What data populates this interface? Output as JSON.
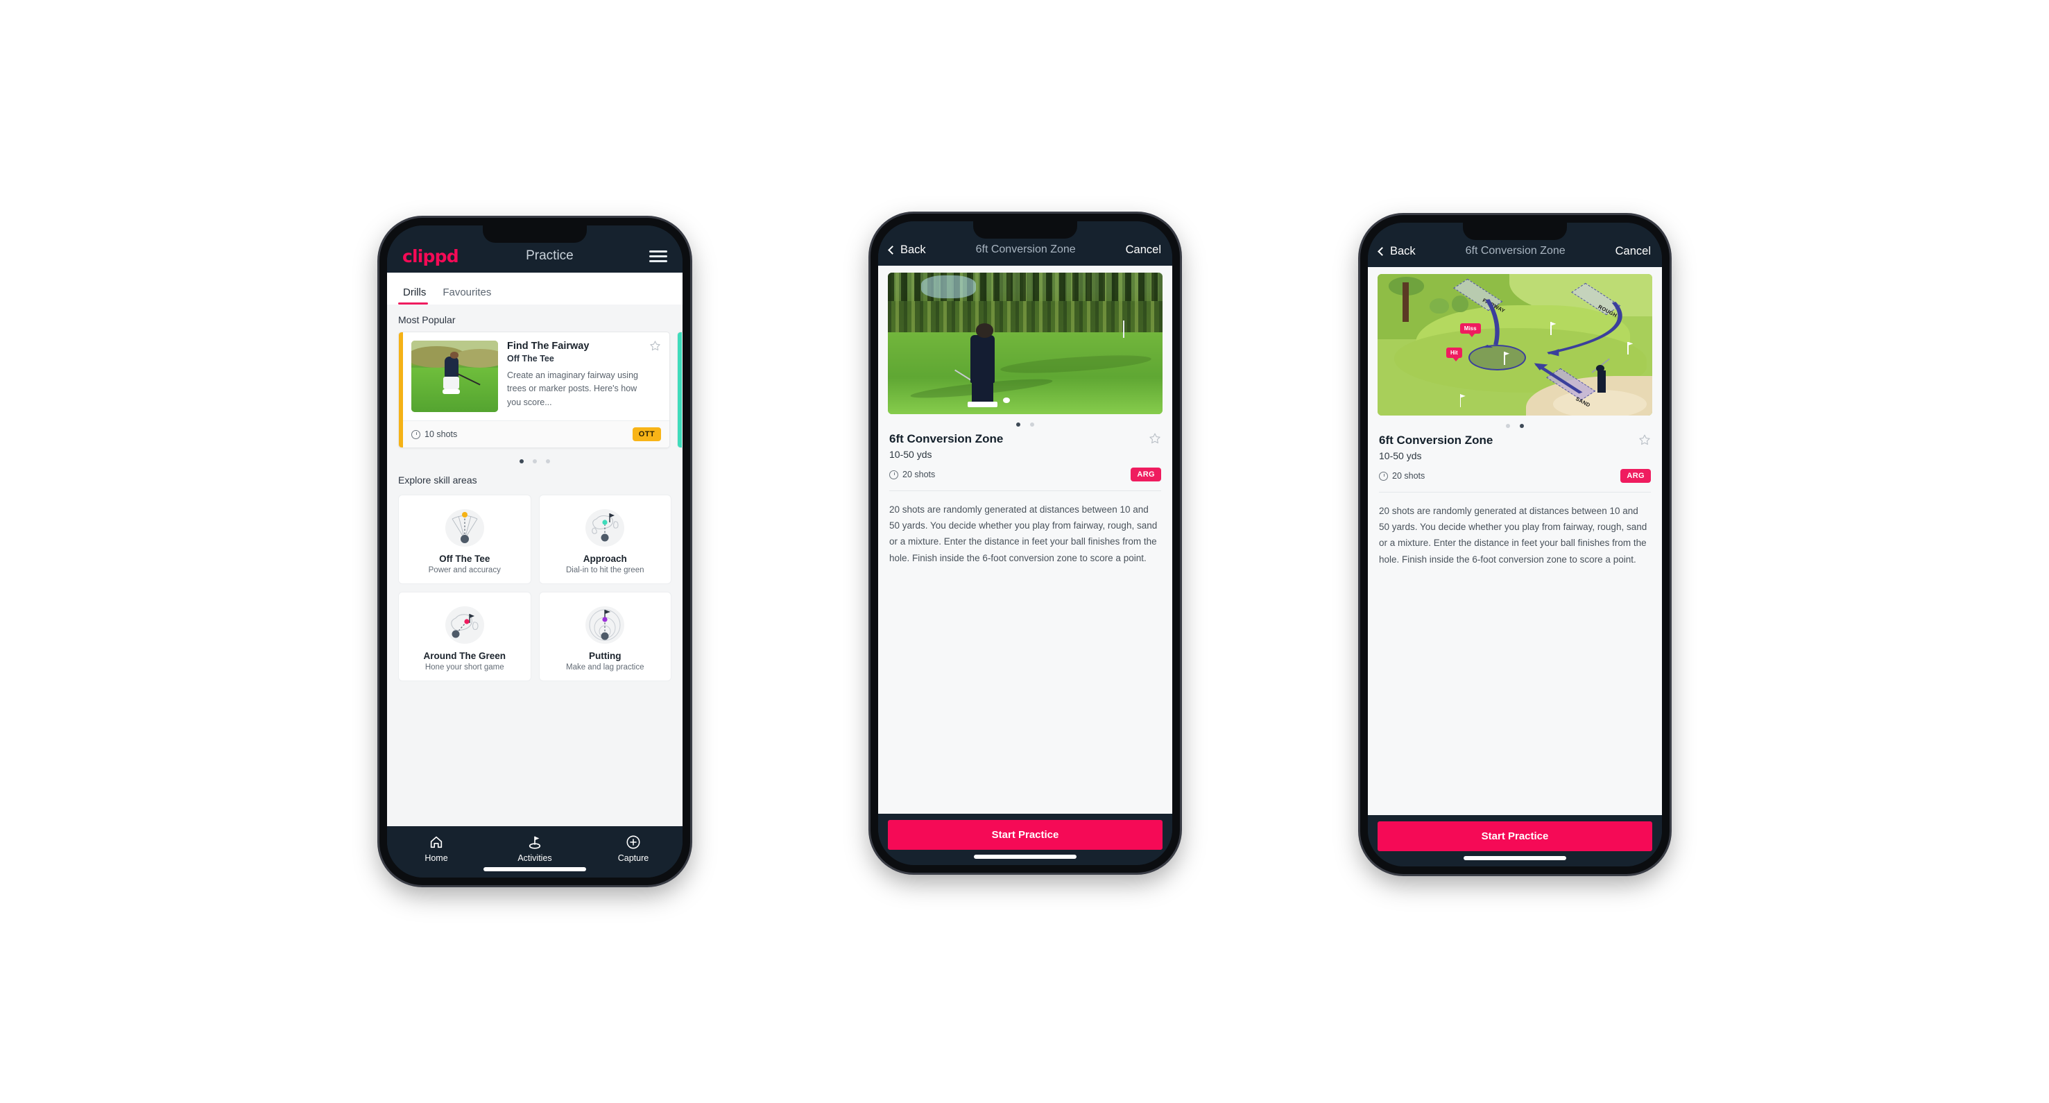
{
  "phone1": {
    "header": {
      "brand": "clippd",
      "title": "Practice",
      "menu_icon": "hamburger-icon"
    },
    "tabs": [
      {
        "label": "Drills",
        "active": true
      },
      {
        "label": "Favourites",
        "active": false
      }
    ],
    "sections": {
      "most_popular_label": "Most Popular",
      "explore_label": "Explore skill areas"
    },
    "drill_card": {
      "title": "Find The Fairway",
      "subtitle": "Off The Tee",
      "description": "Create an imaginary fairway using trees or marker posts. Here's how you score...",
      "shots": "10 shots",
      "badge": "OTT",
      "accent_color": "#f5b216",
      "next_accent_color": "#3fdcbb",
      "star_icon": "star-outline-icon",
      "clock_icon": "clock-icon"
    },
    "carousel_dots": {
      "count": 3,
      "active_index": 0
    },
    "skills": [
      {
        "name": "Off The Tee",
        "desc": "Power and accuracy",
        "icon": "tee-fan-icon",
        "dot_color": "#f5b216"
      },
      {
        "name": "Approach",
        "desc": "Dial-in to hit the green",
        "icon": "approach-green-icon",
        "dot_color": "#3fdcbb"
      },
      {
        "name": "Around The Green",
        "desc": "Hone your short game",
        "icon": "around-green-icon",
        "dot_color": "#ef1c5f"
      },
      {
        "name": "Putting",
        "desc": "Make and lag practice",
        "icon": "putting-rings-icon",
        "dot_color": "#9b30d9"
      }
    ],
    "bottom_nav": [
      {
        "label": "Home",
        "icon": "home-icon",
        "active": false
      },
      {
        "label": "Activities",
        "icon": "golf-flag-icon",
        "active": true
      },
      {
        "label": "Capture",
        "icon": "plus-circle-icon",
        "active": false
      }
    ]
  },
  "phone2": {
    "nav": {
      "back": "Back",
      "title": "6ft Conversion Zone",
      "cancel": "Cancel",
      "back_icon": "chevron-left-icon"
    },
    "media_type": "video-still-golfer-chipping",
    "carousel_dots": {
      "count": 2,
      "active_index": 0
    },
    "detail": {
      "title": "6ft Conversion Zone",
      "subtitle": "10-50 yds",
      "shots": "20 shots",
      "badge": "ARG",
      "badge_color": "#ef1c5f",
      "star_icon": "star-outline-icon",
      "clock_icon": "clock-icon",
      "description": "20 shots are randomly generated at distances between 10 and 50 yards. You decide whether you play from fairway, rough, sand or a mixture. Enter the distance in feet your ball finishes from the hole. Finish inside the 6-foot conversion zone to score a point."
    },
    "cta": "Start Practice"
  },
  "phone3": {
    "nav": {
      "back": "Back",
      "title": "6ft Conversion Zone",
      "cancel": "Cancel",
      "back_icon": "chevron-left-icon"
    },
    "media_type": "golf-hole-diagram",
    "diagram": {
      "zone_labels": [
        "FAIRWAY",
        "ROUGH",
        "SAND"
      ],
      "markers": [
        "Miss",
        "Hit"
      ],
      "marker_color": "#ef1c5f",
      "arrow_color": "#3b3f9c"
    },
    "carousel_dots": {
      "count": 2,
      "active_index": 1
    },
    "detail": {
      "title": "6ft Conversion Zone",
      "subtitle": "10-50 yds",
      "shots": "20 shots",
      "badge": "ARG",
      "star_icon": "star-outline-icon",
      "clock_icon": "clock-icon",
      "description": "20 shots are randomly generated at distances between 10 and 50 yards. You decide whether you play from fairway, rough, sand or a mixture. Enter the distance in feet your ball finishes from the hole. Finish inside the 6-foot conversion zone to score a point."
    },
    "cta": "Start Practice"
  },
  "theme": {
    "dark": "#16222e",
    "pink": "#f50a56",
    "amber": "#f8b417",
    "teal": "#3fdcbb",
    "page_bg": "#f4f5f6"
  }
}
